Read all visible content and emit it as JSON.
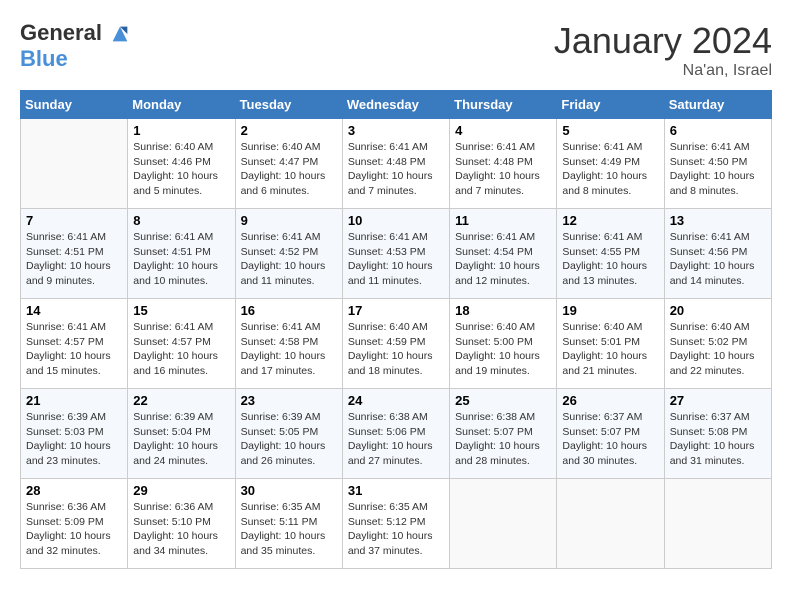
{
  "logo": {
    "line1": "General",
    "line2": "Blue"
  },
  "title": "January 2024",
  "location": "Na'an, Israel",
  "weekdays": [
    "Sunday",
    "Monday",
    "Tuesday",
    "Wednesday",
    "Thursday",
    "Friday",
    "Saturday"
  ],
  "weeks": [
    [
      {
        "day": "",
        "sunrise": "",
        "sunset": "",
        "daylight": ""
      },
      {
        "day": "1",
        "sunrise": "Sunrise: 6:40 AM",
        "sunset": "Sunset: 4:46 PM",
        "daylight": "Daylight: 10 hours and 5 minutes."
      },
      {
        "day": "2",
        "sunrise": "Sunrise: 6:40 AM",
        "sunset": "Sunset: 4:47 PM",
        "daylight": "Daylight: 10 hours and 6 minutes."
      },
      {
        "day": "3",
        "sunrise": "Sunrise: 6:41 AM",
        "sunset": "Sunset: 4:48 PM",
        "daylight": "Daylight: 10 hours and 7 minutes."
      },
      {
        "day": "4",
        "sunrise": "Sunrise: 6:41 AM",
        "sunset": "Sunset: 4:48 PM",
        "daylight": "Daylight: 10 hours and 7 minutes."
      },
      {
        "day": "5",
        "sunrise": "Sunrise: 6:41 AM",
        "sunset": "Sunset: 4:49 PM",
        "daylight": "Daylight: 10 hours and 8 minutes."
      },
      {
        "day": "6",
        "sunrise": "Sunrise: 6:41 AM",
        "sunset": "Sunset: 4:50 PM",
        "daylight": "Daylight: 10 hours and 8 minutes."
      }
    ],
    [
      {
        "day": "7",
        "sunrise": "Sunrise: 6:41 AM",
        "sunset": "Sunset: 4:51 PM",
        "daylight": "Daylight: 10 hours and 9 minutes."
      },
      {
        "day": "8",
        "sunrise": "Sunrise: 6:41 AM",
        "sunset": "Sunset: 4:51 PM",
        "daylight": "Daylight: 10 hours and 10 minutes."
      },
      {
        "day": "9",
        "sunrise": "Sunrise: 6:41 AM",
        "sunset": "Sunset: 4:52 PM",
        "daylight": "Daylight: 10 hours and 11 minutes."
      },
      {
        "day": "10",
        "sunrise": "Sunrise: 6:41 AM",
        "sunset": "Sunset: 4:53 PM",
        "daylight": "Daylight: 10 hours and 11 minutes."
      },
      {
        "day": "11",
        "sunrise": "Sunrise: 6:41 AM",
        "sunset": "Sunset: 4:54 PM",
        "daylight": "Daylight: 10 hours and 12 minutes."
      },
      {
        "day": "12",
        "sunrise": "Sunrise: 6:41 AM",
        "sunset": "Sunset: 4:55 PM",
        "daylight": "Daylight: 10 hours and 13 minutes."
      },
      {
        "day": "13",
        "sunrise": "Sunrise: 6:41 AM",
        "sunset": "Sunset: 4:56 PM",
        "daylight": "Daylight: 10 hours and 14 minutes."
      }
    ],
    [
      {
        "day": "14",
        "sunrise": "Sunrise: 6:41 AM",
        "sunset": "Sunset: 4:57 PM",
        "daylight": "Daylight: 10 hours and 15 minutes."
      },
      {
        "day": "15",
        "sunrise": "Sunrise: 6:41 AM",
        "sunset": "Sunset: 4:57 PM",
        "daylight": "Daylight: 10 hours and 16 minutes."
      },
      {
        "day": "16",
        "sunrise": "Sunrise: 6:41 AM",
        "sunset": "Sunset: 4:58 PM",
        "daylight": "Daylight: 10 hours and 17 minutes."
      },
      {
        "day": "17",
        "sunrise": "Sunrise: 6:40 AM",
        "sunset": "Sunset: 4:59 PM",
        "daylight": "Daylight: 10 hours and 18 minutes."
      },
      {
        "day": "18",
        "sunrise": "Sunrise: 6:40 AM",
        "sunset": "Sunset: 5:00 PM",
        "daylight": "Daylight: 10 hours and 19 minutes."
      },
      {
        "day": "19",
        "sunrise": "Sunrise: 6:40 AM",
        "sunset": "Sunset: 5:01 PM",
        "daylight": "Daylight: 10 hours and 21 minutes."
      },
      {
        "day": "20",
        "sunrise": "Sunrise: 6:40 AM",
        "sunset": "Sunset: 5:02 PM",
        "daylight": "Daylight: 10 hours and 22 minutes."
      }
    ],
    [
      {
        "day": "21",
        "sunrise": "Sunrise: 6:39 AM",
        "sunset": "Sunset: 5:03 PM",
        "daylight": "Daylight: 10 hours and 23 minutes."
      },
      {
        "day": "22",
        "sunrise": "Sunrise: 6:39 AM",
        "sunset": "Sunset: 5:04 PM",
        "daylight": "Daylight: 10 hours and 24 minutes."
      },
      {
        "day": "23",
        "sunrise": "Sunrise: 6:39 AM",
        "sunset": "Sunset: 5:05 PM",
        "daylight": "Daylight: 10 hours and 26 minutes."
      },
      {
        "day": "24",
        "sunrise": "Sunrise: 6:38 AM",
        "sunset": "Sunset: 5:06 PM",
        "daylight": "Daylight: 10 hours and 27 minutes."
      },
      {
        "day": "25",
        "sunrise": "Sunrise: 6:38 AM",
        "sunset": "Sunset: 5:07 PM",
        "daylight": "Daylight: 10 hours and 28 minutes."
      },
      {
        "day": "26",
        "sunrise": "Sunrise: 6:37 AM",
        "sunset": "Sunset: 5:07 PM",
        "daylight": "Daylight: 10 hours and 30 minutes."
      },
      {
        "day": "27",
        "sunrise": "Sunrise: 6:37 AM",
        "sunset": "Sunset: 5:08 PM",
        "daylight": "Daylight: 10 hours and 31 minutes."
      }
    ],
    [
      {
        "day": "28",
        "sunrise": "Sunrise: 6:36 AM",
        "sunset": "Sunset: 5:09 PM",
        "daylight": "Daylight: 10 hours and 32 minutes."
      },
      {
        "day": "29",
        "sunrise": "Sunrise: 6:36 AM",
        "sunset": "Sunset: 5:10 PM",
        "daylight": "Daylight: 10 hours and 34 minutes."
      },
      {
        "day": "30",
        "sunrise": "Sunrise: 6:35 AM",
        "sunset": "Sunset: 5:11 PM",
        "daylight": "Daylight: 10 hours and 35 minutes."
      },
      {
        "day": "31",
        "sunrise": "Sunrise: 6:35 AM",
        "sunset": "Sunset: 5:12 PM",
        "daylight": "Daylight: 10 hours and 37 minutes."
      },
      {
        "day": "",
        "sunrise": "",
        "sunset": "",
        "daylight": ""
      },
      {
        "day": "",
        "sunrise": "",
        "sunset": "",
        "daylight": ""
      },
      {
        "day": "",
        "sunrise": "",
        "sunset": "",
        "daylight": ""
      }
    ]
  ]
}
